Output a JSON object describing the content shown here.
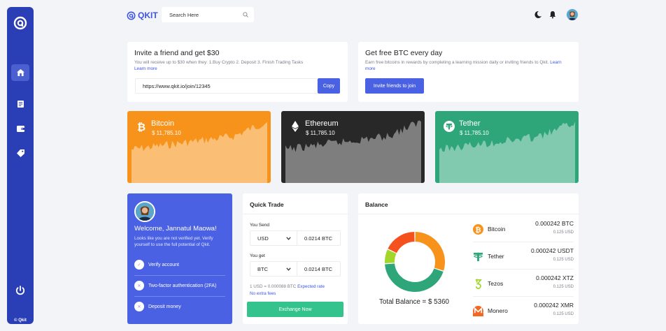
{
  "brand": {
    "name": "QKIT"
  },
  "search": {
    "placeholder": "Search Here"
  },
  "sidebar": {
    "copyright": "© Qkit"
  },
  "invite": {
    "title": "Invite a friend and get $30",
    "desc": "You will receive up to $30 when they:  1.Buy Crypto 2. Deposit 3. Finish Trading Tasks",
    "learn_more": "Learn more",
    "url": "https://www.qkit.io/join/12345",
    "copy_label": "Copy"
  },
  "free_btc": {
    "title": "Get free BTC every day",
    "desc": "Earn free bitcoins in rewards by completing a learning mission daily or inviting friends to Qkit.",
    "learn_more": "Learn more",
    "button": "Invite friends to join"
  },
  "coins": [
    {
      "name": "Bitcoin",
      "price": "$ 11,785.10",
      "color": "#f7931a",
      "icon": "bitcoin-icon"
    },
    {
      "name": "Ethereum",
      "price": "$ 11,785.10",
      "color": "#282828",
      "icon": "ethereum-icon"
    },
    {
      "name": "Tether",
      "price": "$ 11,785.10",
      "color": "#2ea67a",
      "icon": "tether-icon"
    }
  ],
  "welcome": {
    "title": "Welcome, Jannatul Maowa!",
    "desc": "Looks like you are not verified yet. Verify yourself to use the full potential of Qkit.",
    "steps": [
      {
        "label": "Verify account",
        "icon": "check-icon"
      },
      {
        "label": "Two-factor authentication (2FA)",
        "icon": "close-icon"
      },
      {
        "label": "Deposit money",
        "icon": "close-icon"
      }
    ]
  },
  "quick_trade": {
    "title": "Quick Trade",
    "send_label": "You Send",
    "send_currency": "USD",
    "send_value": "0.0214 BTC",
    "get_label": "You get",
    "get_currency": "BTC",
    "get_value": "0.0214 BTC",
    "rate": "1 USD = 0.000088 BTC",
    "expected_rate": "Expected rate",
    "no_fees": "No extra fees",
    "button": "Exchange Now"
  },
  "balance": {
    "title": "Balance",
    "total": "Total Balance = $ 5360",
    "segments": [
      {
        "color": "#f7931a",
        "value": 30
      },
      {
        "color": "#2ea67a",
        "value": 44
      },
      {
        "color": "#a2d62a",
        "value": 8
      },
      {
        "color": "#f4511e",
        "value": 18
      }
    ],
    "items": [
      {
        "name": "Bitcoin",
        "amount": "0.000242 BTC",
        "usd": "0.125 USD",
        "icon": "bitcoin-icon"
      },
      {
        "name": "Tether",
        "amount": "0.000242 USDT",
        "usd": "0.125 USD",
        "icon": "tether-icon"
      },
      {
        "name": "Tezos",
        "amount": "0.000242 XTZ",
        "usd": "0.125 USD",
        "icon": "tezos-icon"
      },
      {
        "name": "Monero",
        "amount": "0.000242 XMR",
        "usd": "0.125 USD",
        "icon": "monero-icon"
      }
    ]
  }
}
